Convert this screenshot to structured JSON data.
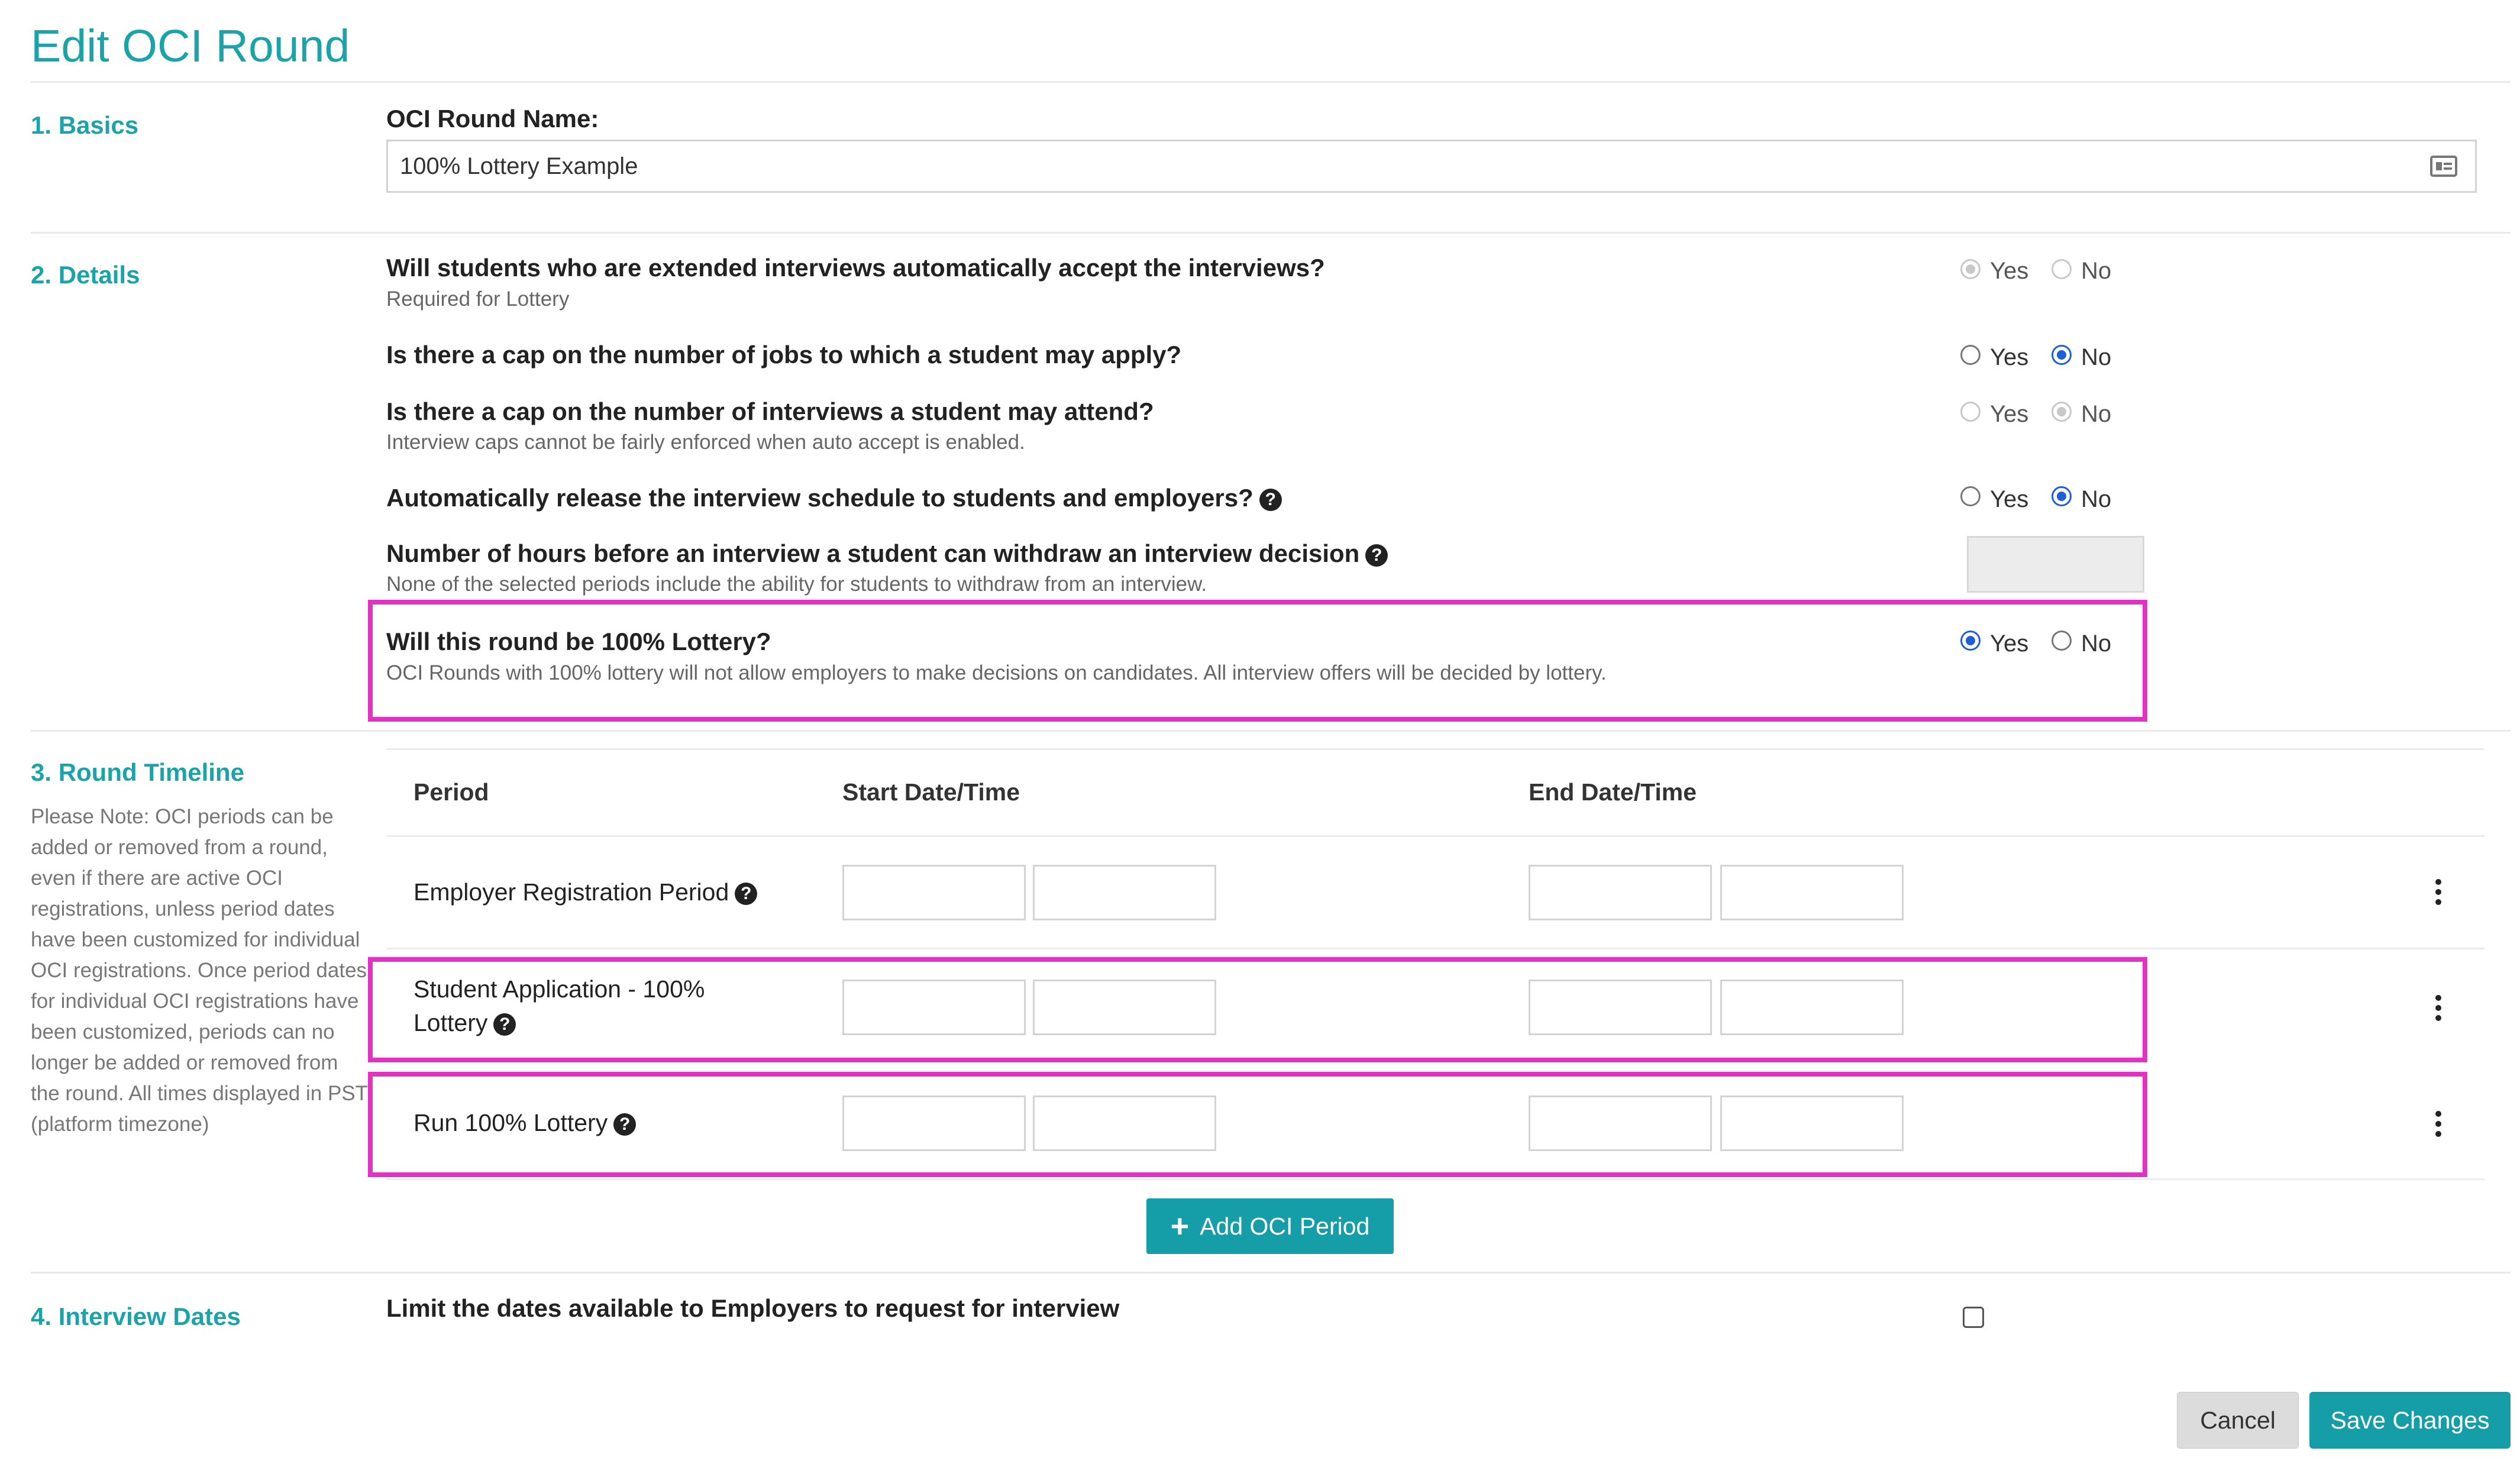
{
  "page": {
    "title": "Edit OCI Round"
  },
  "basics": {
    "section_title": "1. Basics",
    "name_label": "OCI Round Name:",
    "name_value": "100% Lottery Example",
    "name_icon": "contact-card-icon"
  },
  "details": {
    "section_title": "2. Details",
    "questions": [
      {
        "label": "Will students who are extended interviews automatically accept the interviews?",
        "sublabel": "Required for Lottery",
        "yes": "Yes",
        "no": "No",
        "selected": "yes",
        "disabled": true
      },
      {
        "label": "Is there a cap on the number of jobs to which a student may apply?",
        "sublabel": "",
        "yes": "Yes",
        "no": "No",
        "selected": "no",
        "disabled": false
      },
      {
        "label": "Is there a cap on the number of interviews a student may attend?",
        "sublabel": "Interview caps cannot be fairly enforced when auto accept is enabled.",
        "yes": "Yes",
        "no": "No",
        "selected": "no",
        "disabled": true
      },
      {
        "label": "Automatically release the interview schedule to students and employers?",
        "sublabel": "",
        "yes": "Yes",
        "no": "No",
        "selected": "no",
        "disabled": false
      },
      {
        "label": "Number of hours before an interview a student can withdraw an interview decision",
        "sublabel": "None of the selected periods include the ability for students to withdraw from an interview."
      },
      {
        "label": "Will this round be 100% Lottery?",
        "sublabel": "OCI Rounds with 100% lottery will not allow employers to make decisions on candidates. All interview offers will be decided by lottery.",
        "yes": "Yes",
        "no": "No",
        "selected": "yes",
        "disabled": false
      }
    ]
  },
  "timeline": {
    "section_title": "3. Round Timeline",
    "note": "Please Note: OCI periods can be added or removed from a round, even if there are active OCI registrations, unless period dates have been customized for individual OCI registrations. Once period dates for individual OCI registrations have been customized, periods can no longer be added or removed from the round. All times displayed in PST (platform timezone)",
    "headers": {
      "period": "Period",
      "start": "Start Date/Time",
      "end": "End Date/Time"
    },
    "rows": [
      {
        "label_line1": "Employer Registration Period",
        "label_line2": ""
      },
      {
        "label_line1": "Student Application - 100%",
        "label_line2": "Lottery"
      },
      {
        "label_line1": "Run 100% Lottery",
        "label_line2": ""
      }
    ],
    "add_button": "Add OCI Period"
  },
  "interview_dates": {
    "section_title": "4. Interview Dates",
    "limit_label": "Limit the dates available to Employers to request for interview",
    "checked": false
  },
  "footer": {
    "cancel": "Cancel",
    "save": "Save Changes"
  },
  "colors": {
    "accent": "#1aa3a9",
    "button": "#159da8",
    "highlight": "#e332c2",
    "radio": "#1e5fd6"
  }
}
